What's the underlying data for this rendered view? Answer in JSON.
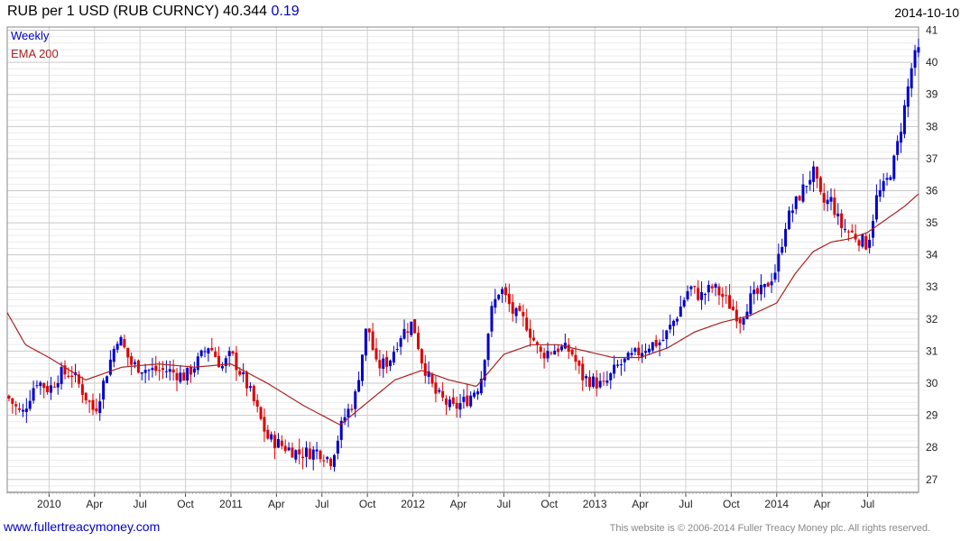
{
  "header": {
    "title": "RUB per 1 USD (RUB CURNCY) 40.344",
    "change": "0.19",
    "date": "2014-10-10"
  },
  "footer": {
    "link": "www.fullertreacymoney.com",
    "copyright": "This website is © 2006-2014 Fuller Treacy Money plc. All rights reserved."
  },
  "colors": {
    "up": "#0000cc",
    "down": "#dd0000",
    "ema": "#aa2222",
    "grid": "#d8d8d8",
    "legend_weekly": "#0000cc",
    "legend_ema": "#aa2222"
  },
  "chart_data": {
    "type": "candlestick",
    "title": "RUB per 1 USD (RUB CURNCY)",
    "legend": [
      {
        "name": "Weekly",
        "color": "#0000cc"
      },
      {
        "name": "EMA 200",
        "color": "#aa2222"
      }
    ],
    "legend_position": "top-left",
    "grid": true,
    "ylim": [
      26.6,
      41.1
    ],
    "yticks": [
      27,
      28,
      29,
      30,
      31,
      32,
      33,
      34,
      35,
      36,
      37,
      38,
      39,
      40,
      41
    ],
    "x_range": [
      2009.77,
      2014.78
    ],
    "xticks": [
      {
        "label": "2010",
        "x": 2010.0
      },
      {
        "label": "Apr",
        "x": 2010.25
      },
      {
        "label": "Jul",
        "x": 2010.5
      },
      {
        "label": "Oct",
        "x": 2010.75
      },
      {
        "label": "2011",
        "x": 2011.0
      },
      {
        "label": "Apr",
        "x": 2011.25
      },
      {
        "label": "Jul",
        "x": 2011.5
      },
      {
        "label": "Oct",
        "x": 2011.75
      },
      {
        "label": "2012",
        "x": 2012.0
      },
      {
        "label": "Apr",
        "x": 2012.25
      },
      {
        "label": "Jul",
        "x": 2012.5
      },
      {
        "label": "Oct",
        "x": 2012.75
      },
      {
        "label": "2013",
        "x": 2013.0
      },
      {
        "label": "Apr",
        "x": 2013.25
      },
      {
        "label": "Jul",
        "x": 2013.5
      },
      {
        "label": "Oct",
        "x": 2013.75
      },
      {
        "label": "2014",
        "x": 2014.0
      },
      {
        "label": "Apr",
        "x": 2014.25
      },
      {
        "label": "Jul",
        "x": 2014.5
      }
    ],
    "weekly_close_keypoints": [
      [
        2009.77,
        29.6
      ],
      [
        2009.85,
        29.0
      ],
      [
        2009.93,
        30.1
      ],
      [
        2010.0,
        29.8
      ],
      [
        2010.06,
        30.3
      ],
      [
        2010.13,
        30.3
      ],
      [
        2010.25,
        29.1
      ],
      [
        2010.32,
        30.4
      ],
      [
        2010.38,
        31.5
      ],
      [
        2010.45,
        30.6
      ],
      [
        2010.55,
        30.4
      ],
      [
        2010.65,
        30.4
      ],
      [
        2010.75,
        30.2
      ],
      [
        2010.82,
        30.7
      ],
      [
        2010.88,
        31.2
      ],
      [
        2010.95,
        30.5
      ],
      [
        2011.0,
        30.9
      ],
      [
        2011.1,
        29.8
      ],
      [
        2011.2,
        28.3
      ],
      [
        2011.3,
        28.0
      ],
      [
        2011.38,
        27.8
      ],
      [
        2011.48,
        27.9
      ],
      [
        2011.55,
        27.6
      ],
      [
        2011.62,
        28.9
      ],
      [
        2011.68,
        29.5
      ],
      [
        2011.75,
        31.9
      ],
      [
        2011.8,
        30.5
      ],
      [
        2011.87,
        30.7
      ],
      [
        2011.93,
        31.5
      ],
      [
        2012.0,
        31.9
      ],
      [
        2012.05,
        30.7
      ],
      [
        2012.12,
        29.7
      ],
      [
        2012.22,
        29.2
      ],
      [
        2012.3,
        29.5
      ],
      [
        2012.37,
        30.0
      ],
      [
        2012.43,
        32.2
      ],
      [
        2012.48,
        33.0
      ],
      [
        2012.55,
        32.2
      ],
      [
        2012.62,
        31.9
      ],
      [
        2012.7,
        30.9
      ],
      [
        2012.8,
        31.1
      ],
      [
        2012.87,
        31.0
      ],
      [
        2012.93,
        30.2
      ],
      [
        2013.05,
        29.9
      ],
      [
        2013.12,
        30.5
      ],
      [
        2013.2,
        30.8
      ],
      [
        2013.3,
        31.2
      ],
      [
        2013.37,
        31.3
      ],
      [
        2013.45,
        32.1
      ],
      [
        2013.52,
        33.0
      ],
      [
        2013.58,
        32.7
      ],
      [
        2013.65,
        33.0
      ],
      [
        2013.72,
        32.6
      ],
      [
        2013.8,
        32.0
      ],
      [
        2013.85,
        32.6
      ],
      [
        2013.93,
        32.9
      ],
      [
        2014.0,
        33.6
      ],
      [
        2014.05,
        35.0
      ],
      [
        2014.13,
        35.9
      ],
      [
        2014.2,
        36.6
      ],
      [
        2014.25,
        35.6
      ],
      [
        2014.3,
        35.7
      ],
      [
        2014.35,
        34.9
      ],
      [
        2014.43,
        34.6
      ],
      [
        2014.5,
        34.3
      ],
      [
        2014.55,
        35.8
      ],
      [
        2014.6,
        36.2
      ],
      [
        2014.65,
        37.0
      ],
      [
        2014.7,
        38.5
      ],
      [
        2014.74,
        39.8
      ],
      [
        2014.77,
        40.34
      ]
    ],
    "ema200_keypoints": [
      [
        2009.77,
        32.2
      ],
      [
        2009.87,
        31.2
      ],
      [
        2010.0,
        30.8
      ],
      [
        2010.2,
        30.1
      ],
      [
        2010.4,
        30.5
      ],
      [
        2010.6,
        30.6
      ],
      [
        2010.8,
        30.5
      ],
      [
        2011.0,
        30.6
      ],
      [
        2011.2,
        30.0
      ],
      [
        2011.4,
        29.3
      ],
      [
        2011.6,
        28.7
      ],
      [
        2011.75,
        29.4
      ],
      [
        2011.9,
        30.1
      ],
      [
        2012.05,
        30.4
      ],
      [
        2012.2,
        30.1
      ],
      [
        2012.35,
        29.9
      ],
      [
        2012.5,
        30.9
      ],
      [
        2012.65,
        31.2
      ],
      [
        2012.8,
        31.2
      ],
      [
        2012.95,
        31.0
      ],
      [
        2013.1,
        30.8
      ],
      [
        2013.25,
        30.8
      ],
      [
        2013.4,
        31.1
      ],
      [
        2013.55,
        31.6
      ],
      [
        2013.7,
        31.9
      ],
      [
        2013.85,
        32.1
      ],
      [
        2014.0,
        32.5
      ],
      [
        2014.1,
        33.4
      ],
      [
        2014.2,
        34.1
      ],
      [
        2014.3,
        34.4
      ],
      [
        2014.4,
        34.5
      ],
      [
        2014.5,
        34.7
      ],
      [
        2014.6,
        35.1
      ],
      [
        2014.7,
        35.5
      ],
      [
        2014.78,
        35.9
      ]
    ]
  }
}
